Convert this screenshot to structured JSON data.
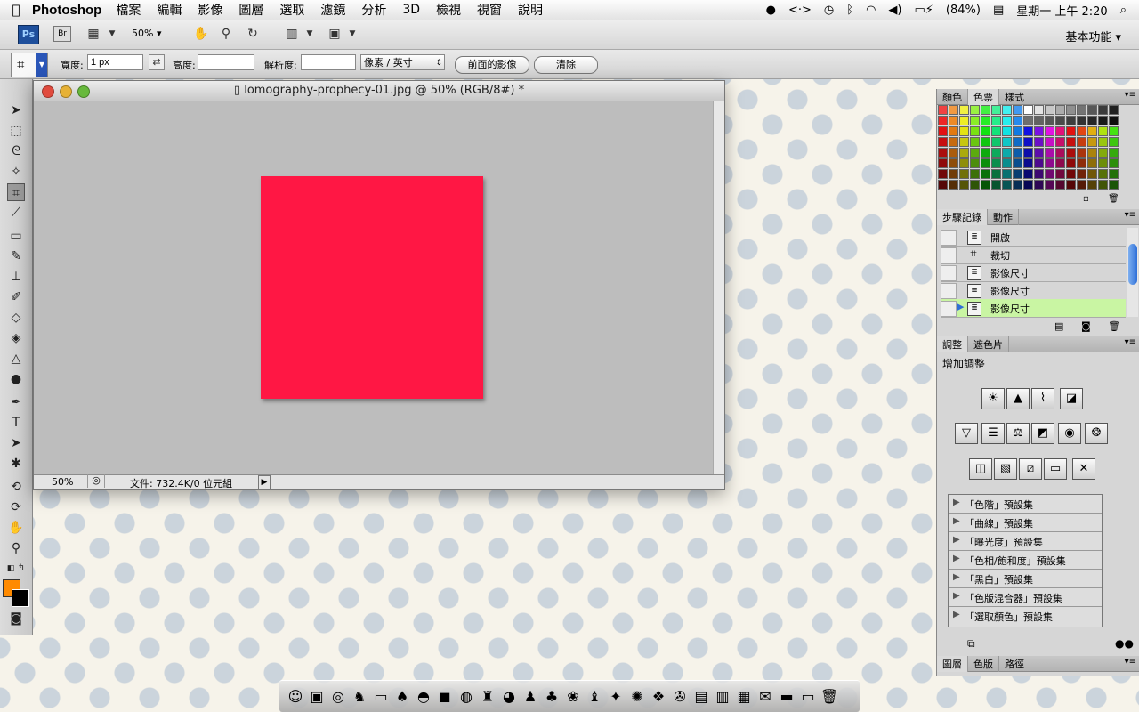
{
  "menubar": {
    "app_name": "Photoshop",
    "items": [
      "檔案",
      "編輯",
      "影像",
      "圖層",
      "選取",
      "濾鏡",
      "分析",
      "3D",
      "檢視",
      "視窗",
      "說明"
    ],
    "battery": "(84%)",
    "clock": "星期一 上午 2:20"
  },
  "apptoolbar": {
    "ps_badge": "Ps",
    "br_badge": "Br",
    "zoom": "50%",
    "workspace": "基本功能"
  },
  "options": {
    "width_label": "寬度:",
    "width_value": "1 px",
    "height_label": "高度:",
    "height_value": "",
    "resolution_label": "解析度:",
    "resolution_value": "",
    "unit": "像素 / 英寸",
    "front_image_button": "前面的影像",
    "clear_button": "清除"
  },
  "document": {
    "title": "lomography-prophecy-01.jpg @ 50% (RGB/8#) *",
    "zoom": "50%",
    "file_info": "文件: 732.4K/0 位元組",
    "canvas_color": "#ff1744"
  },
  "panels": {
    "color_tabs": [
      "顏色",
      "色票",
      "樣式"
    ],
    "history_tabs": [
      "步驟記錄",
      "動作"
    ],
    "history_items": [
      "開啟",
      "裁切",
      "影像尺寸",
      "影像尺寸",
      "影像尺寸"
    ],
    "adjust_tabs": [
      "調整",
      "遮色片"
    ],
    "adjust_title": "增加調整",
    "presets": [
      "「色階」預設集",
      "「曲線」預設集",
      "「曝光度」預設集",
      "「色相/飽和度」預設集",
      "「黑白」預設集",
      "「色版混合器」預設集",
      "「選取顏色」預設集"
    ],
    "layers_tabs": [
      "圖層",
      "色版",
      "路徑"
    ]
  },
  "colors": {
    "foreground": "#ff8a00",
    "background": "#000000",
    "history_active": "#c9f5a3"
  }
}
